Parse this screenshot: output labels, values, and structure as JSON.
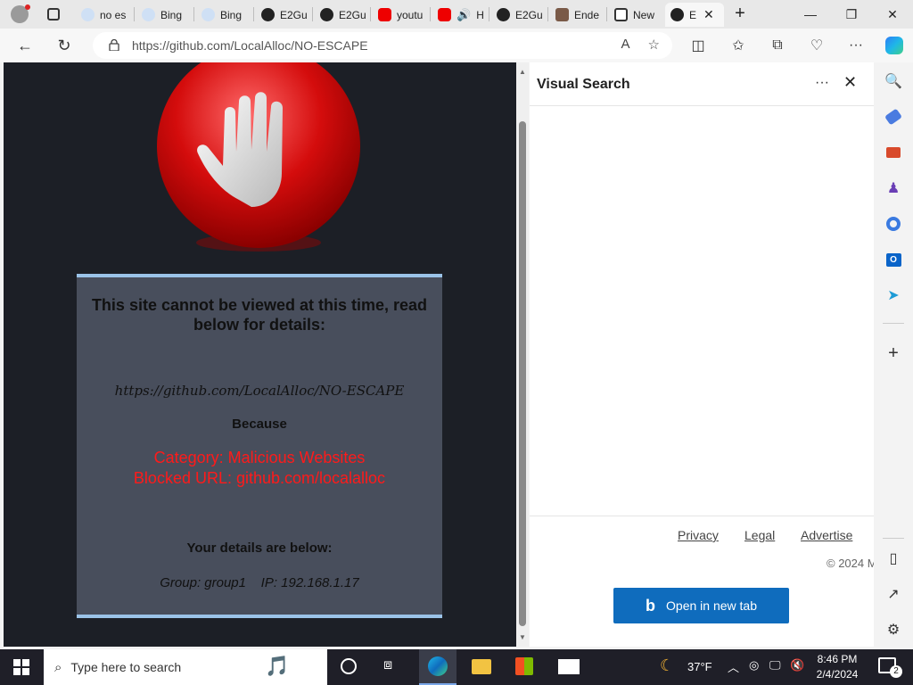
{
  "browser": {
    "tabs": [
      {
        "label": "no es",
        "icon": "search-icon"
      },
      {
        "label": "Bing",
        "icon": "search-icon"
      },
      {
        "label": "Bing",
        "icon": "search-icon"
      },
      {
        "label": "E2Gu",
        "icon": "github-icon"
      },
      {
        "label": "E2Gu",
        "icon": "github-icon"
      },
      {
        "label": "youtu",
        "icon": "youtube-icon"
      },
      {
        "label": "H",
        "icon": "youtube-icon"
      },
      {
        "label": "E2Gu",
        "icon": "github-icon"
      },
      {
        "label": "Ende",
        "icon": "avatar-icon"
      },
      {
        "label": "New",
        "icon": "newtab-icon"
      },
      {
        "label": "E",
        "icon": "github-icon"
      }
    ],
    "url": "https://github.com/LocalAlloc/NO-ESCAPE"
  },
  "blocked_page": {
    "heading": "This site cannot be viewed at this time, read below for details:",
    "blocked_url": "https://github.com/LocalAlloc/NO-ESCAPE",
    "because": "Because",
    "category": "Category: Malicious Websites",
    "blocked_line": "Blocked URL: github.com/localalloc",
    "details_heading": "Your details are below:",
    "group": "Group: group1",
    "ip": "IP: 192.168.1.17"
  },
  "visual_search": {
    "title": "Visual Search",
    "more_label": "···",
    "links": {
      "privacy": "Privacy",
      "legal": "Legal",
      "advertise": "Advertise"
    },
    "copyright": "© 2024 M",
    "open_button": "Open in new tab"
  },
  "taskbar": {
    "search_placeholder": "Type here to search",
    "weather": "37°F",
    "time": "8:46 PM",
    "date": "2/4/2024",
    "notifications": "2"
  },
  "colors": {
    "accent": "#0f6cbd",
    "blocked_red": "#ff1a1a",
    "box_border": "#9bc3e8"
  }
}
